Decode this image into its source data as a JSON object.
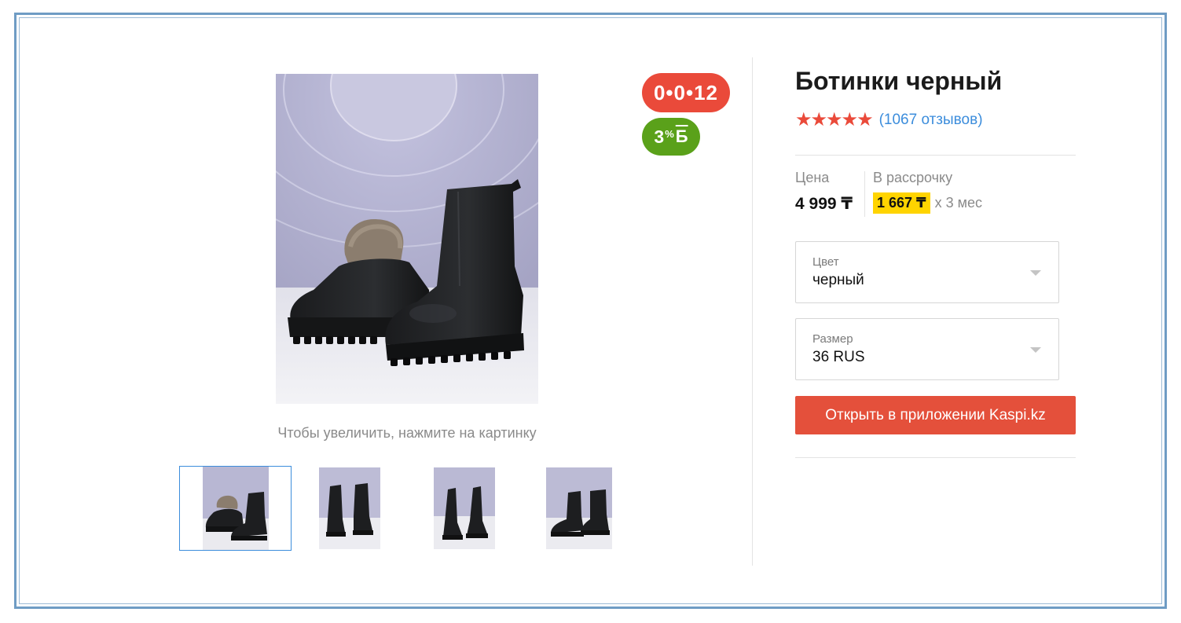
{
  "product": {
    "title": "Ботинки черный",
    "rating_stars": "★★★★★",
    "rating": 4.5,
    "reviews_text": "(1067 отзывов)"
  },
  "badges": {
    "installment": "0•0•12",
    "bonus_value": "3",
    "bonus_percent": "%",
    "bonus_currency": "Б"
  },
  "gallery": {
    "zoom_hint": "Чтобы увеличить, нажмите на картинку",
    "thumbnail_count": 4,
    "active_thumbnail": 1
  },
  "pricing": {
    "price_label": "Цена",
    "price_value": "4 999 ₸",
    "credit_label": "В рассрочку",
    "credit_amount": "1 667 ₸",
    "credit_term": "x 3 мес"
  },
  "options": {
    "color_label": "Цвет",
    "color_value": "черный",
    "size_label": "Размер",
    "size_value": "36 RUS"
  },
  "actions": {
    "open_app_label": "Открыть в приложении Kaspi.kz"
  },
  "colors": {
    "accent_red": "#e4503b",
    "bonus_green": "#5aa11a",
    "link_blue": "#3c8ddc",
    "highlight_yellow": "#ffd400",
    "frame_blue": "#6f9cc4"
  }
}
